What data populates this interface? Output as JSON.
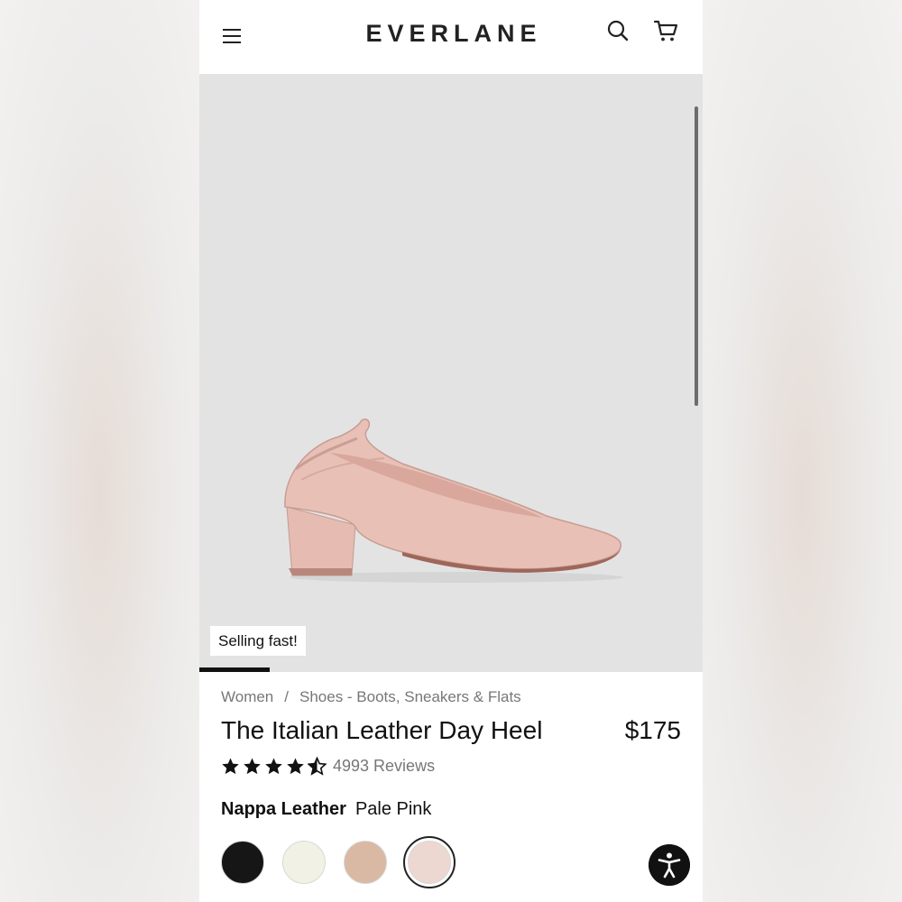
{
  "header": {
    "logo": "EVERLANE",
    "icons": [
      "menu-icon",
      "search-icon",
      "cart-icon"
    ]
  },
  "gallery": {
    "badge": "Selling fast!",
    "carousel_progress": 0.14
  },
  "product": {
    "breadcrumb": [
      "Women",
      "/",
      "Shoes - Boots, Sneakers & Flats"
    ],
    "title": "The Italian Leather Day Heel",
    "price": "$175",
    "rating": 4.5,
    "reviews": "4993 Reviews",
    "material_label": "Nappa Leather",
    "color_name": "Pale Pink",
    "swatches": [
      {
        "color": "#161616",
        "selected": false
      },
      {
        "color": "#f2f1e6",
        "selected": false
      },
      {
        "color": "#d9b9a3",
        "selected": false
      },
      {
        "color": "#ecd7d1",
        "selected": true
      }
    ]
  },
  "colors": {
    "shoe": "#e7bdb3",
    "shoe_shadow": "#c99e94",
    "gallery_bg": "#e3e3e4"
  }
}
